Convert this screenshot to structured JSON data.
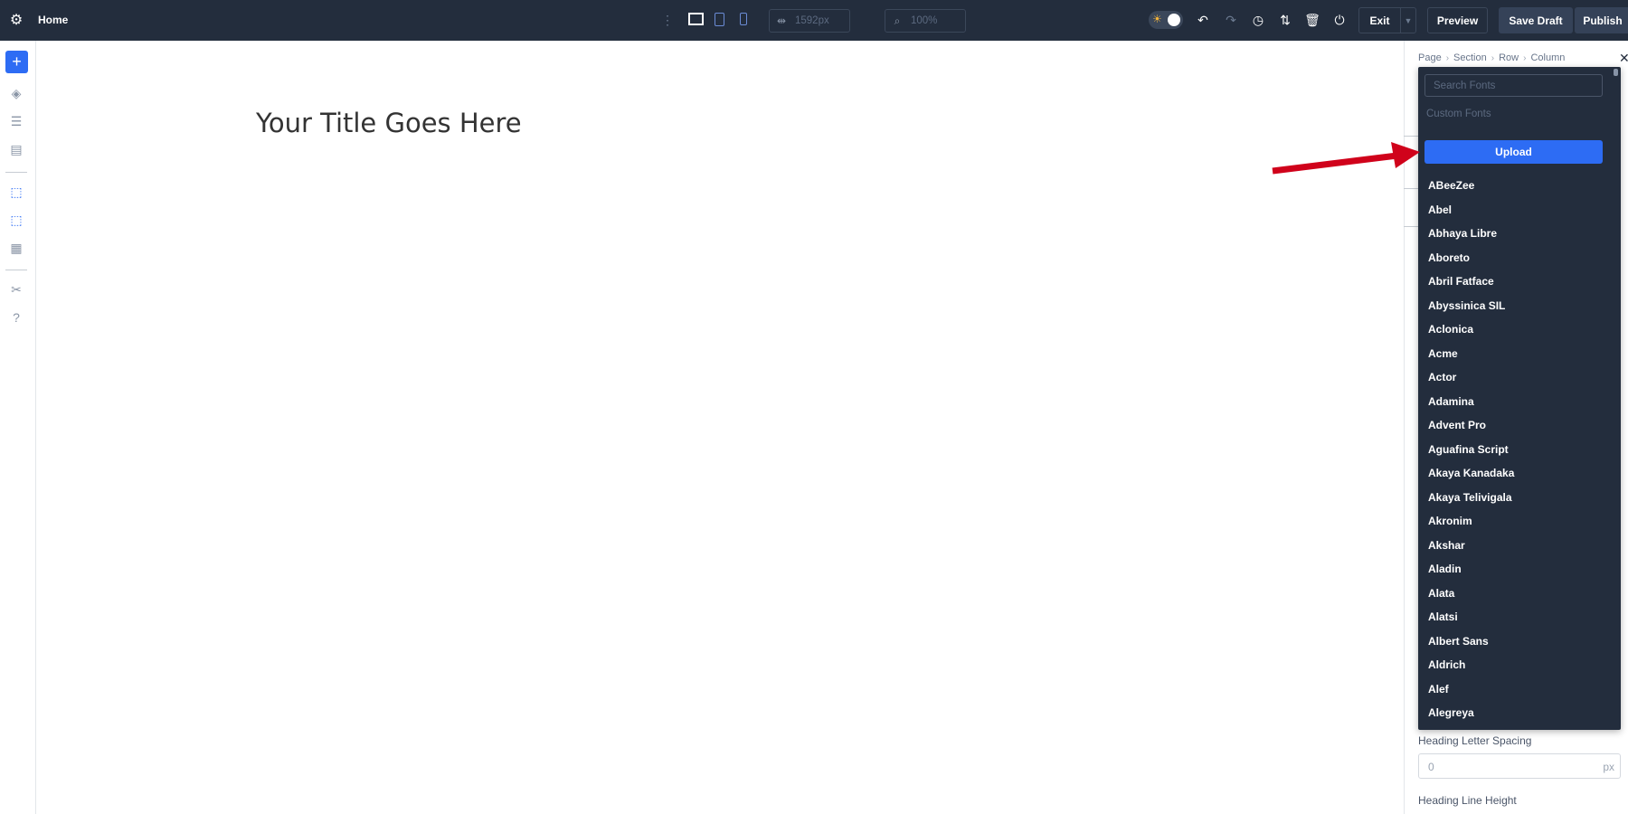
{
  "topbar": {
    "page_name": "Home",
    "width_value": "1592px",
    "zoom_value": "100%",
    "exit_label": "Exit",
    "preview_label": "Preview",
    "save_draft_label": "Save Draft",
    "publish_label": "Publish"
  },
  "canvas": {
    "title": "Your Title Goes Here"
  },
  "panel": {
    "breadcrumb": [
      "Page",
      "Section",
      "Row",
      "Column"
    ],
    "heading_letter_spacing_label": "Heading Letter Spacing",
    "heading_letter_spacing_value": "0",
    "heading_letter_spacing_unit": "px",
    "heading_line_height_label": "Heading Line Height"
  },
  "font_dropdown": {
    "search_placeholder": "Search Fonts",
    "custom_fonts_label": "Custom Fonts",
    "upload_label": "Upload",
    "fonts": [
      "ABeeZee",
      "Abel",
      "Abhaya Libre",
      "Aboreto",
      "Abril Fatface",
      "Abyssinica SIL",
      "Aclonica",
      "Acme",
      "Actor",
      "Adamina",
      "Advent Pro",
      "Aguafina Script",
      "Akaya Kanadaka",
      "Akaya Telivigala",
      "Akronim",
      "Akshar",
      "Aladin",
      "Alata",
      "Alatsi",
      "Albert Sans",
      "Aldrich",
      "Alef",
      "Alegreya"
    ]
  },
  "colors": {
    "topbar_bg": "#232d3d",
    "accent_blue": "#2d6cf4",
    "arrow_red": "#d0021b"
  }
}
